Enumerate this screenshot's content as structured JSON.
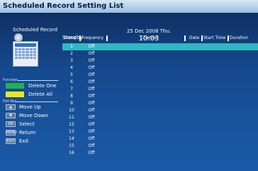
{
  "window": {
    "title": "Scheduled Record Setting List"
  },
  "top": {
    "scheduled_record_label": "Scheduled Record",
    "scheduled_record_value": "Standby",
    "date": "25 Dec 2008 Thu.",
    "time": "10:03"
  },
  "left": {
    "function_label": "Function",
    "delete_one": "Delete One",
    "delete_all": "Delete All",
    "hotkey_label": "Hot Key",
    "move_up": "Move Up",
    "move_down": "Move Down",
    "select": "Select",
    "return": "Return",
    "exit": "Exit",
    "btn_ok": "OK",
    "btn_menu": "MENU",
    "btn_exit": "EXIT",
    "colors": {
      "delete_one_key": "#22b14c",
      "delete_all_key": "#f2e51b"
    }
  },
  "table": {
    "headers": [
      "Group",
      "Frequency",
      "Channel",
      "Date",
      "Start Time",
      "Duration"
    ],
    "rows": [
      {
        "group": "1",
        "frequency": "Off"
      },
      {
        "group": "2",
        "frequency": "Off"
      },
      {
        "group": "3",
        "frequency": "Off"
      },
      {
        "group": "4",
        "frequency": "Off"
      },
      {
        "group": "5",
        "frequency": "Off"
      },
      {
        "group": "6",
        "frequency": "Off"
      },
      {
        "group": "7",
        "frequency": "Off"
      },
      {
        "group": "8",
        "frequency": "Off"
      },
      {
        "group": "9",
        "frequency": "Off"
      },
      {
        "group": "10",
        "frequency": "Off"
      },
      {
        "group": "11",
        "frequency": "Off"
      },
      {
        "group": "12",
        "frequency": "Off"
      },
      {
        "group": "13",
        "frequency": "Off"
      },
      {
        "group": "14",
        "frequency": "Off"
      },
      {
        "group": "15",
        "frequency": "Off"
      },
      {
        "group": "16",
        "frequency": "Off"
      }
    ],
    "selected_row": 0,
    "selection_color": "#2fb7c4"
  }
}
